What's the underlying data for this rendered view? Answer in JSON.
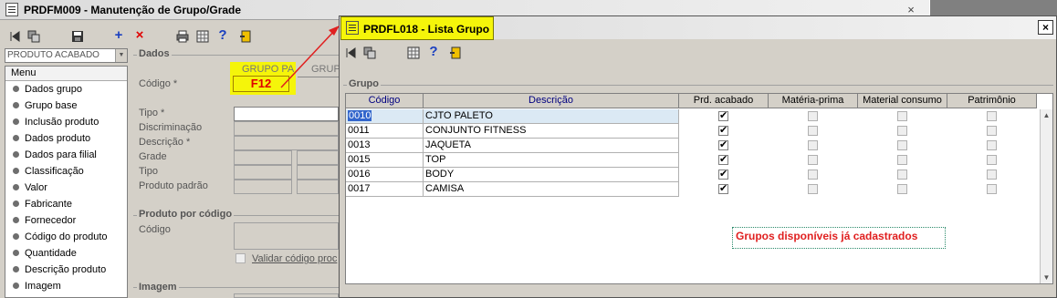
{
  "main_window": {
    "title": "PRDFM009 - Manutenção de Grupo/Grade",
    "close_label": "×",
    "toolbar": {
      "add_label": "+",
      "delete_label": "×",
      "help_label": "?"
    },
    "combo_value": "PRODUTO ACABADO",
    "menu": {
      "header": "Menu",
      "items": [
        "Dados grupo",
        "Grupo base",
        "Inclusão produto",
        "Dados produto",
        "Dados para filial",
        "Classificação",
        "Valor",
        "Fabricante",
        "Fornecedor",
        "Código do produto",
        "Quantidade",
        "Descrição produto",
        "Imagem"
      ]
    },
    "dados": {
      "group_label": "Dados",
      "tab_grupo_pa": "GRUPO PA",
      "tab_grupo_other": "GRUP",
      "codigo_label": "Código *",
      "codigo_value": "F12",
      "tipo_label": "Tipo *",
      "discriminacao_label": "Discriminação",
      "descricao_label": "Descrição *",
      "grade_label": "Grade",
      "tipo2_label": "Tipo",
      "produto_padrao_label": "Produto padrão"
    },
    "produto_por_codigo": {
      "group_label": "Produto por código",
      "codigo_label": "Código",
      "validar_label": "Validar código proc"
    },
    "imagem": {
      "group_label": "Imagem"
    }
  },
  "dialog": {
    "title": "PRDFL018 - Lista Grupo",
    "close_label": "×",
    "help_label": "?",
    "group_label": "Grupo",
    "columns": [
      "Código",
      "Descrição",
      "Prd. acabado",
      "Matéria-prima",
      "Material consumo",
      "Patrimônio"
    ],
    "rows": [
      {
        "codigo": "0010",
        "descricao": "CJTO PALETO",
        "prd_acabado": true,
        "materia_prima": false,
        "material_consumo": false,
        "patrimonio": false
      },
      {
        "codigo": "0011",
        "descricao": "CONJUNTO FITNESS",
        "prd_acabado": true,
        "materia_prima": false,
        "material_consumo": false,
        "patrimonio": false
      },
      {
        "codigo": "0013",
        "descricao": "JAQUETA",
        "prd_acabado": true,
        "materia_prima": false,
        "material_consumo": false,
        "patrimonio": false
      },
      {
        "codigo": "0015",
        "descricao": "TOP",
        "prd_acabado": true,
        "materia_prima": false,
        "material_consumo": false,
        "patrimonio": false
      },
      {
        "codigo": "0016",
        "descricao": "BODY",
        "prd_acabado": true,
        "materia_prima": false,
        "material_consumo": false,
        "patrimonio": false
      },
      {
        "codigo": "0017",
        "descricao": "CAMISA",
        "prd_acabado": true,
        "materia_prima": false,
        "material_consumo": false,
        "patrimonio": false
      }
    ],
    "note": "Grupos disponíveis já cadastrados",
    "scroll_up": "▲",
    "scroll_down": "▼"
  },
  "colors": {
    "highlight_yellow": "#f5f50a",
    "arrow_red": "#e02020",
    "note_red": "#e02020",
    "header_blue": "#000080",
    "window_gray": "#d4d0c8"
  }
}
